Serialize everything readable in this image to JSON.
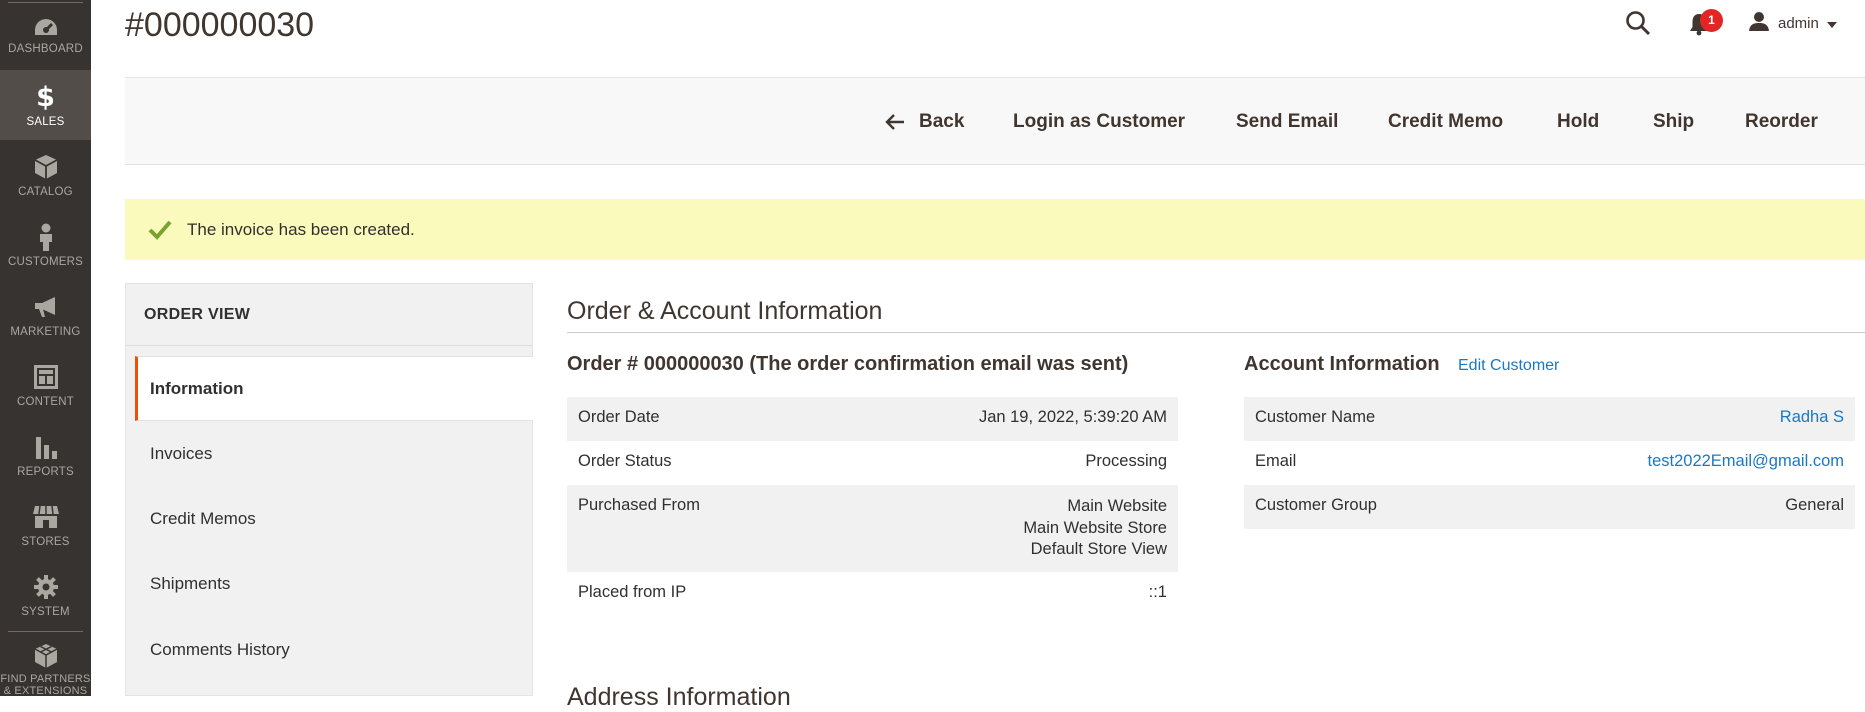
{
  "menu": {
    "items": [
      {
        "label": "DASHBOARD",
        "icon": "dashboard-icon"
      },
      {
        "label": "SALES",
        "icon": "dollar-icon",
        "active": true
      },
      {
        "label": "CATALOG",
        "icon": "box-icon"
      },
      {
        "label": "CUSTOMERS",
        "icon": "person-icon"
      },
      {
        "label": "MARKETING",
        "icon": "megaphone-icon"
      },
      {
        "label": "CONTENT",
        "icon": "layout-icon"
      },
      {
        "label": "REPORTS",
        "icon": "bar-chart-icon"
      },
      {
        "label": "STORES",
        "icon": "storefront-icon"
      },
      {
        "label": "SYSTEM",
        "icon": "gear-icon"
      },
      {
        "label": "FIND PARTNERS & EXTENSIONS",
        "icon": "blocks-icon"
      }
    ]
  },
  "header": {
    "title": "#000000030",
    "notifications_count": "1",
    "user_name": "admin"
  },
  "actions": {
    "back": "Back",
    "login_as_customer": "Login as Customer",
    "send_email": "Send Email",
    "credit_memo": "Credit Memo",
    "hold": "Hold",
    "ship": "Ship",
    "reorder": "Reorder"
  },
  "message": {
    "text": "The invoice has been created."
  },
  "sidebar": {
    "title": "ORDER VIEW",
    "tabs": [
      "Information",
      "Invoices",
      "Credit Memos",
      "Shipments",
      "Comments History"
    ]
  },
  "main": {
    "section_title": "Order & Account Information",
    "order_block_title": "Order # 000000030 (The order confirmation email was sent)",
    "order_rows": [
      {
        "label": "Order Date",
        "value": "Jan 19, 2022, 5:39:20 AM"
      },
      {
        "label": "Order Status",
        "value": "Processing"
      },
      {
        "label": "Purchased From",
        "value_lines": [
          "Main Website",
          "Main Website Store",
          "Default Store View"
        ]
      },
      {
        "label": "Placed from IP",
        "value": "::1"
      }
    ],
    "account_block_title": "Account Information",
    "edit_customer_link": "Edit Customer",
    "account_rows": [
      {
        "label": "Customer Name",
        "value": "Radha S"
      },
      {
        "label": "Email",
        "value": "test2022Email@gmail.com"
      },
      {
        "label": "Customer Group",
        "value": "General"
      }
    ],
    "next_section_title": "Address Information"
  },
  "colors": {
    "menu_bg": "#373330",
    "menu_active_bg": "#524d49",
    "accent": "#eb5202",
    "link": "#1979c3",
    "message_bg": "#fafabc",
    "success_check": "#79a22e",
    "badge": "#e22626"
  }
}
